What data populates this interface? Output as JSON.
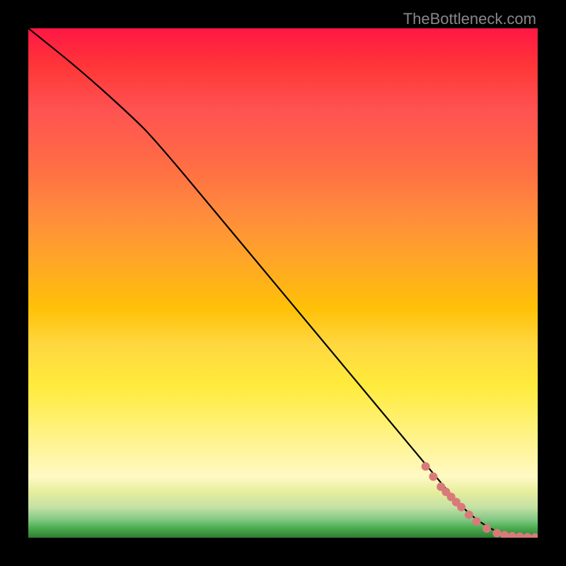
{
  "attribution": "TheBottleneck.com",
  "chart_data": {
    "type": "line",
    "title": "",
    "xlabel": "",
    "ylabel": "",
    "xlim": [
      0,
      100
    ],
    "ylim": [
      0,
      100
    ],
    "gradient_stops": [
      {
        "pos": 0,
        "color": "#ff1744"
      },
      {
        "pos": 0.5,
        "color": "#ffc107"
      },
      {
        "pos": 0.78,
        "color": "#fff176"
      },
      {
        "pos": 1.0,
        "color": "#2e7d32"
      }
    ],
    "series": [
      {
        "name": "curve",
        "x": [
          0,
          10,
          20,
          25,
          40,
          55,
          70,
          80,
          85,
          90,
          95,
          100
        ],
        "y": [
          100,
          92,
          83,
          78,
          60,
          42,
          24,
          12,
          6,
          2,
          0,
          0
        ]
      }
    ],
    "points": {
      "name": "markers",
      "x": [
        78,
        79.5,
        81,
        82,
        83,
        84,
        85,
        86.5,
        88,
        90,
        92,
        93.5,
        95,
        96.5,
        98,
        99.5
      ],
      "y": [
        14,
        12,
        10,
        9,
        8,
        7,
        6,
        4.5,
        3.2,
        1.8,
        0.9,
        0.5,
        0.3,
        0.2,
        0.1,
        0.05
      ]
    }
  }
}
